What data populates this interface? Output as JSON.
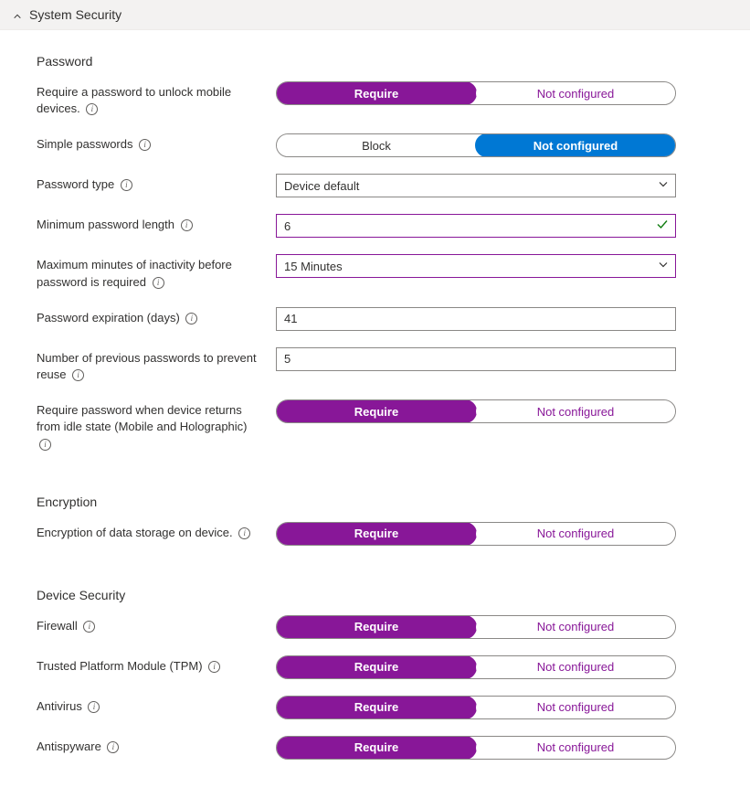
{
  "header": {
    "title": "System Security"
  },
  "sections": {
    "password": {
      "title": "Password"
    },
    "encryption": {
      "title": "Encryption"
    },
    "device_security": {
      "title": "Device Security"
    }
  },
  "toggle": {
    "require": "Require",
    "not_configured": "Not configured",
    "block": "Block"
  },
  "fields": {
    "require_password_unlock": {
      "label": "Require a password to unlock mobile devices."
    },
    "simple_passwords": {
      "label": "Simple passwords"
    },
    "password_type": {
      "label": "Password type",
      "value": "Device default"
    },
    "min_pw_length": {
      "label": "Minimum password length",
      "value": "6"
    },
    "max_inactivity": {
      "label": "Maximum minutes of inactivity before password is required",
      "value": "15 Minutes"
    },
    "pw_expiration": {
      "label": "Password expiration (days)",
      "value": "41"
    },
    "prev_pw_reuse": {
      "label": "Number of previous passwords to prevent reuse",
      "value": "5"
    },
    "require_pw_idle": {
      "label": "Require password when device returns from idle state (Mobile and Holographic)"
    },
    "encryption_storage": {
      "label": "Encryption of data storage on device."
    },
    "firewall": {
      "label": "Firewall"
    },
    "tpm": {
      "label": "Trusted Platform Module (TPM)"
    },
    "antivirus": {
      "label": "Antivirus"
    },
    "antispyware": {
      "label": "Antispyware"
    }
  }
}
